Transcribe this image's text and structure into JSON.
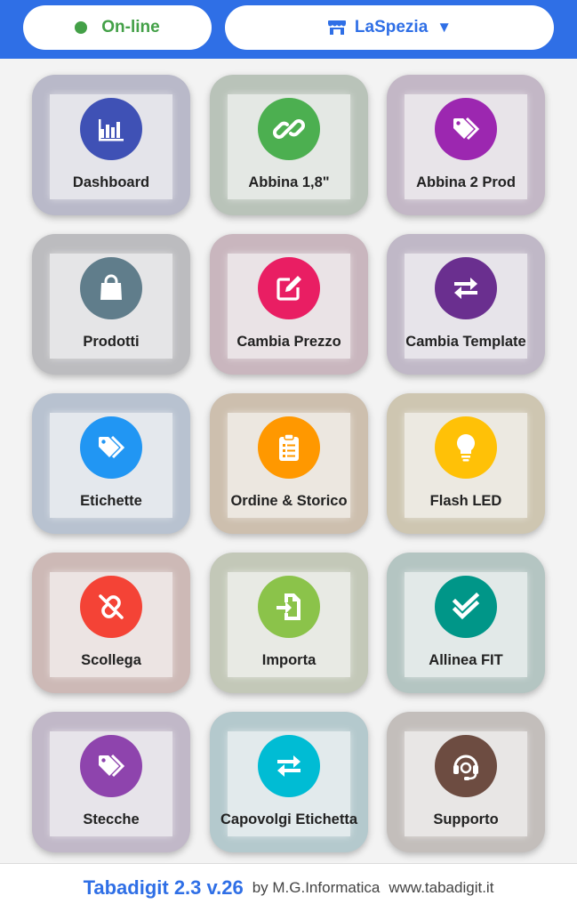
{
  "header": {
    "status_label": "On-line",
    "store_label": "LaSpezia",
    "caret": "▼",
    "colors": {
      "bar": "#2f6fe6",
      "status": "#43a047"
    }
  },
  "tiles": [
    {
      "label": "Dashboard",
      "icon": "chart-bars-icon",
      "color": "#3f51b5",
      "tile": "#b9b9c9"
    },
    {
      "label": "Abbina 1,8\"",
      "icon": "link-icon",
      "color": "#4caf50",
      "tile": "#b9c3b9"
    },
    {
      "label": "Abbina 2 Prod",
      "icon": "tag-icon",
      "color": "#9c27b0",
      "tile": "#c3b7c6"
    },
    {
      "label": "Prodotti",
      "icon": "shopping-bag-icon",
      "color": "#607d8b",
      "tile": "#bcbcbf"
    },
    {
      "label": "Cambia Prezzo",
      "icon": "edit-icon",
      "color": "#e91e63",
      "tile": "#c9b6be"
    },
    {
      "label": "Cambia Template",
      "icon": "swap-arrows-icon",
      "color": "#6a2f8f",
      "tile": "#c0b8c7"
    },
    {
      "label": "Etichette",
      "icon": "tag-icon",
      "color": "#2196f3",
      "tile": "#b8c2d0"
    },
    {
      "label": "Ordine & Storico",
      "icon": "clipboard-list-icon",
      "color": "#ff9800",
      "tile": "#cdbfae"
    },
    {
      "label": "Flash LED",
      "icon": "lightbulb-icon",
      "color": "#ffc107",
      "tile": "#cec6b1"
    },
    {
      "label": "Scollega",
      "icon": "unlink-icon",
      "color": "#f44336",
      "tile": "#cdb9b6"
    },
    {
      "label": "Importa",
      "icon": "file-import-icon",
      "color": "#8bc34a",
      "tile": "#c3c8b8"
    },
    {
      "label": "Allinea FIT",
      "icon": "double-check-icon",
      "color": "#009688",
      "tile": "#b4c5c2"
    },
    {
      "label": "Stecche",
      "icon": "tag-icon",
      "color": "#8e44ad",
      "tile": "#c1b8c8"
    },
    {
      "label": "Capovolgi Etichetta",
      "icon": "swap-arrows-icon",
      "color": "#00bcd4",
      "tile": "#b4c9cd"
    },
    {
      "label": "Supporto",
      "icon": "headset-icon",
      "color": "#6d4c41",
      "tile": "#c3bebb"
    }
  ],
  "footer": {
    "brand": "Tabadigit 2.3 v.26",
    "credit": "by M.G.Informatica",
    "site": "www.tabadigit.it"
  }
}
